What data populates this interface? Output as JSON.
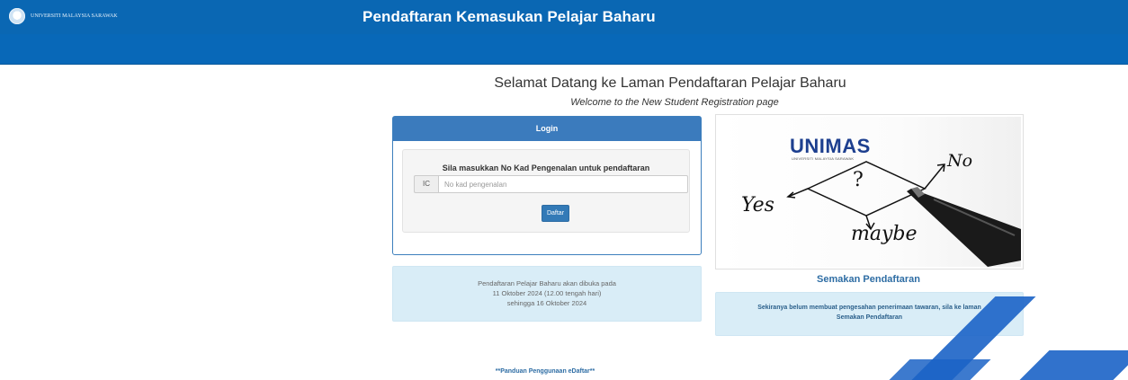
{
  "header": {
    "logo_text": "UNIVERSITI MALAYSIA SARAWAK",
    "title": "Pendaftaran Kemasukan Pelajar Baharu"
  },
  "welcome": {
    "title": "Selamat Datang ke Laman Pendaftaran Pelajar Baharu",
    "subtitle_en": "Welcome to the New Student Registration page"
  },
  "login": {
    "heading": "Login",
    "prompt": "Sila masukkan No Kad Pengenalan untuk pendaftaran",
    "ic_label": "IC",
    "ic_placeholder": "No kad pengenalan",
    "ic_value": "",
    "submit_label": "Daftar"
  },
  "notice": {
    "lines": [
      "Pendaftaran Pelajar Baharu akan dibuka pada",
      "11 Oktober 2024 (12.00 tengah hari)",
      "sehingga 16 Oktober 2024"
    ]
  },
  "image_card": {
    "logo_text": "UNIMAS",
    "logo_subtext": "UNIVERSITI MALAYSIA SARAWAK",
    "words": {
      "yes": "Yes",
      "no": "No",
      "maybe": "maybe",
      "question": "?"
    }
  },
  "semakan": {
    "title": "Semakan Pendaftaran",
    "lines": [
      "Sekiranya belum membuat pengesahan penerimaan tawaran, sila ke laman",
      "Semakan Pendaftaran"
    ]
  },
  "footer": {
    "guide_link": "**Panduan Penggunaan eDaftar**"
  },
  "colors": {
    "header_bg": "#0a67b3",
    "panel_heading": "#3b7bbd",
    "info_bg": "#d9edf7",
    "link": "#2e6da4"
  }
}
